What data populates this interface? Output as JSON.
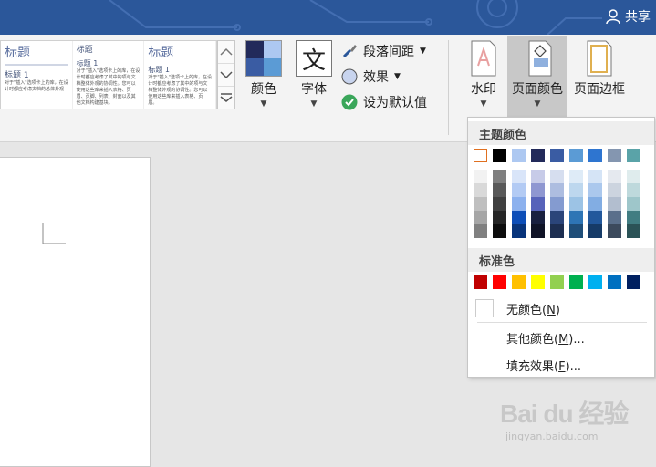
{
  "header": {
    "share_label": "共享",
    "accent": "#2b579a"
  },
  "gallery": {
    "styles": [
      {
        "title": "标题",
        "heading": "标题 1",
        "body": "对于\"插入\"选项卡上的库，在设计时都应考虑文档的总体外观"
      },
      {
        "title": "标题",
        "heading": "标题 1",
        "body": "对于\"插入\"选项卡上的库，在设计时都应考虑了其中的项与文档整体外观的协调性。您可以使用这些库来插入表格、页眉、页脚、列表、封面以及其他文档构建基块。"
      },
      {
        "title": "标题",
        "heading": "标题 1",
        "body": "对于\"插入\"选项卡上的库，在设计时都应考虑了其中的项与文档整体外观的协调性。您可以使用这些库来插入表格、页眉。"
      }
    ]
  },
  "ribbon": {
    "colors_label": "颜色",
    "fonts_label": "字体",
    "font_glyph": "文",
    "paragraph_spacing_label": "段落间距",
    "effects_label": "效果",
    "set_default_label": "设为默认值",
    "watermark_label": "水印",
    "page_color_label": "页面颜色",
    "page_borders_label": "页面边框"
  },
  "dropdown": {
    "theme_colors_header": "主题颜色",
    "standard_colors_header": "标准色",
    "no_color_label": "无颜色(N)",
    "no_color_pre": "无颜色(",
    "no_color_key": "N",
    "no_color_post": ")",
    "more_colors_pre": "其他颜色(",
    "more_colors_key": "M",
    "more_colors_post": ")...",
    "fill_effects_pre": "填充效果(",
    "fill_effects_key": "F",
    "fill_effects_post": ")...",
    "theme_colors": [
      "#ffffff",
      "#000000",
      "#adc8f1",
      "#222a5a",
      "#3a5ca3",
      "#5b9bd5",
      "#2e75d0",
      "#8496b0",
      "#5aa3a8"
    ],
    "theme_shades": [
      [
        "#f2f2f2",
        "#d9d9d9",
        "#bfbfbf",
        "#a6a6a6",
        "#808080"
      ],
      [
        "#7f7f7f",
        "#595959",
        "#404040",
        "#262626",
        "#0d0d0d"
      ],
      [
        "#d9e5f9",
        "#b3cbf4",
        "#8cb1ee",
        "#0d4eb8",
        "#08347b"
      ],
      [
        "#c7cbe8",
        "#8f97d1",
        "#5763ba",
        "#19203f",
        "#0f1326"
      ],
      [
        "#d6deef",
        "#adbde0",
        "#849bd0",
        "#2b457a",
        "#1d2e51"
      ],
      [
        "#deebf7",
        "#bdd7ee",
        "#9cc3e5",
        "#2e75b5",
        "#1f4e79"
      ],
      [
        "#d5e4f6",
        "#abc8ed",
        "#82ade3",
        "#22589c",
        "#163b68"
      ],
      [
        "#e5e9ef",
        "#ccd4df",
        "#b2becf",
        "#5a6f8b",
        "#3c4a5d"
      ],
      [
        "#dfeced",
        "#bed9dc",
        "#9ec6ca",
        "#417d82",
        "#2b5357"
      ]
    ],
    "standard_colors": [
      "#c00000",
      "#ff0000",
      "#ffc000",
      "#ffff00",
      "#92d050",
      "#00b050",
      "#00b0f0",
      "#0070c0",
      "#002060"
    ]
  },
  "watermark": {
    "brand": "Bai du 经验",
    "url": "jingyan.baidu.com"
  }
}
